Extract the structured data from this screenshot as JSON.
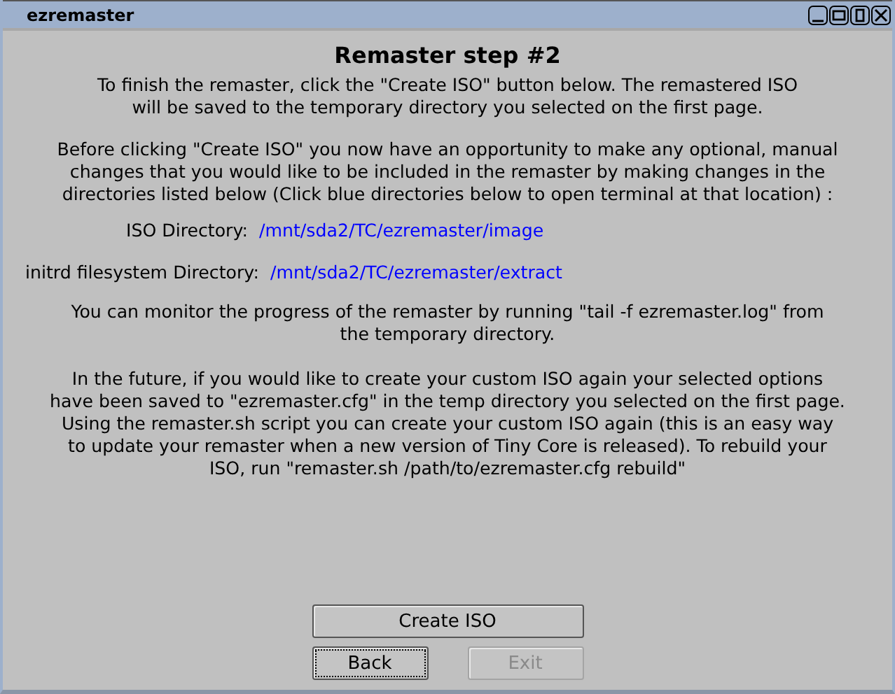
{
  "window": {
    "title": "ezremaster"
  },
  "heading": "Remaster step #2",
  "intro": [
    "To finish the remaster, click the \"Create ISO\" button below.  The remastered ISO",
    "will be saved to the temporary directory you selected on the first page."
  ],
  "instructions": [
    "Before clicking \"Create ISO\" you now have an opportunity to make any optional, manual",
    "changes that you would like to be included in the remaster by making changes in the",
    "directories listed below (Click blue directories below to open terminal at that location) :"
  ],
  "directories": [
    {
      "label": "ISO Directory:",
      "path": "/mnt/sda2/TC/ezremaster/image"
    },
    {
      "label": "initrd filesystem Directory:",
      "path": "/mnt/sda2/TC/ezremaster/extract"
    }
  ],
  "monitor": [
    "You can monitor the progress of the remaster by running \"tail -f ezremaster.log\" from",
    "the temporary directory."
  ],
  "future": [
    "In the future, if you would like to create your custom ISO again your selected options",
    "have been saved to \"ezremaster.cfg\" in the temp directory you selected on the first page.",
    "Using the remaster.sh script you can create your custom ISO again (this is an easy way",
    "to update your remaster when a new version of Tiny Core is released).  To rebuild your",
    "ISO, run \"remaster.sh /path/to/ezremaster.cfg rebuild\""
  ],
  "buttons": {
    "create": {
      "label": "Create ISO",
      "disabled": false,
      "focused": false
    },
    "back": {
      "label": "Back",
      "disabled": false,
      "focused": true
    },
    "exit": {
      "label": "Exit",
      "disabled": true,
      "focused": false
    }
  }
}
